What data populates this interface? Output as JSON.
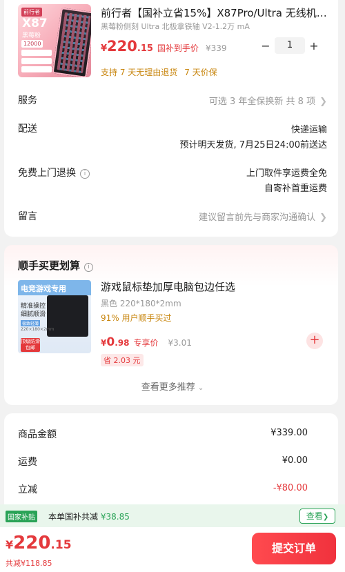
{
  "product": {
    "image_texts": {
      "brand": "前行者",
      "model": "X87",
      "sub": "黑莓粉",
      "badge": "12000"
    },
    "title": "前行者【国补立省15%】X87Pro/Ultra 无线机…",
    "spec": "黑莓粉侧刻 Ultra 北极拿铁轴 V2-1.2万 mA",
    "price_currency": "¥",
    "price_int": "220",
    "price_dec": ".15",
    "subsidy_label": "国补到手价",
    "original_price": "¥339",
    "quantity": "1",
    "minus": "−",
    "plus": "+",
    "guarantee_1": "支持 7 天无理由退货",
    "guarantee_2": "7 天价保"
  },
  "rows": {
    "service": {
      "label": "服务",
      "value": "可选 3 年全保换新 共 8 项"
    },
    "delivery": {
      "label": "配送",
      "value_line1": "快递运输",
      "value_line2": "预计明天发货, 7月25日24:00前送达"
    },
    "free_return": {
      "label": "免费上门退换",
      "value_line1": "上门取件享运费全免",
      "value_line2": "自寄补首重运费"
    },
    "message": {
      "label": "留言",
      "value": "建议留言前先与商家沟通确认"
    }
  },
  "addon": {
    "section_title": "顺手买更划算",
    "image_texts": {
      "top": "电竞游戏专用",
      "line1": "精准操控",
      "line2": "细腻顺滑",
      "tag": "极致轻薄",
      "tiny": "220×180×2mm",
      "red": "顶级防滑 包邮"
    },
    "title": "游戏鼠标垫加厚电脑包边任选",
    "spec": "黑色 220*180*2mm",
    "stat": "91% 用户顺手买过",
    "price_currency": "¥",
    "price_int": "0",
    "price_dec": ".98",
    "exclusive_label": "专享价",
    "original_price": "¥3.01",
    "save": "省 2.03 元",
    "add": "+",
    "more": "查看更多推荐"
  },
  "summary": {
    "goods_label": "商品金额",
    "goods_value": "¥339.00",
    "shipping_label": "运费",
    "shipping_value": "¥0.00",
    "discount_label": "立减",
    "discount_value": "-¥80.00"
  },
  "subsidy_bar": {
    "tag": "国家补贴",
    "text": "本单国补共减",
    "amount": "¥38.85",
    "view": "查看"
  },
  "footer": {
    "currency": "¥",
    "total_int": "220",
    "total_dec": ".15",
    "saved": "共减¥118.85",
    "submit": "提交订单"
  },
  "colors": {
    "accent_red": "#e4393c",
    "subsidy_green": "#2aa357",
    "guarantee_gold": "#c8860f"
  }
}
